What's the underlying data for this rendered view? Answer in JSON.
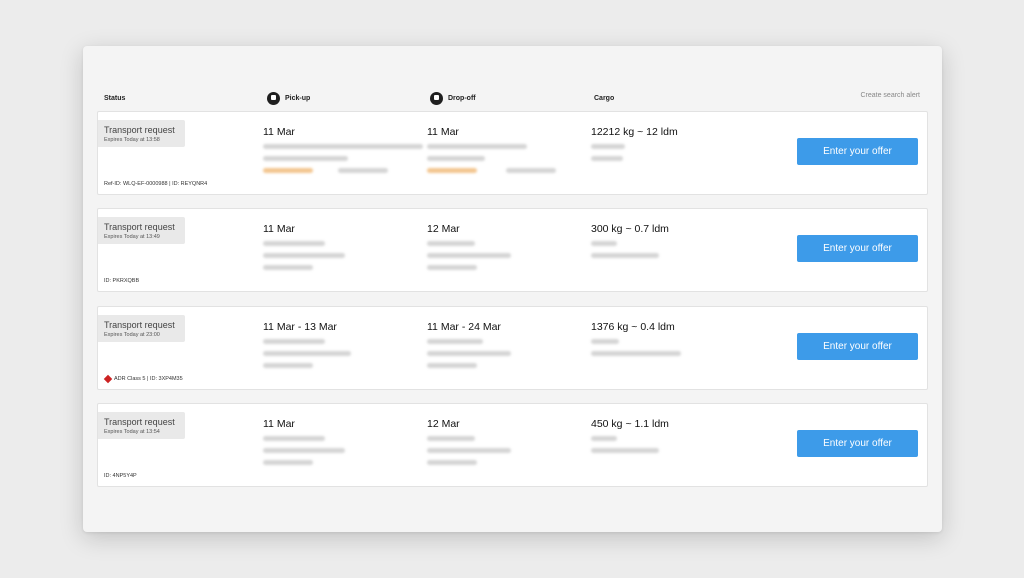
{
  "header": {
    "columns": {
      "status": "Status",
      "pickup": "Pick-up",
      "dropoff": "Drop-off",
      "cargo": "Cargo"
    },
    "search_alert": "Create search alert"
  },
  "requests": [
    {
      "status": "Transport request",
      "expiry": "Expires Today at 13:58",
      "ref": "Ref-ID: WLQ-EF-0000988 | ID: REYQNR4",
      "pickup_date": "11 Mar",
      "dropoff_date": "11 Mar",
      "cargo": "12212 kg ~ 12 ldm",
      "offer_label": "Enter your offer"
    },
    {
      "status": "Transport request",
      "expiry": "Expires Today at 13:49",
      "ref": "ID: PKRXQBB",
      "pickup_date": "11 Mar",
      "dropoff_date": "12 Mar",
      "cargo": "300 kg ~ 0.7 ldm",
      "offer_label": "Enter your offer"
    },
    {
      "status": "Transport request",
      "expiry": "Expires Today at 23:00",
      "ref": "ADR Class 5 | ID: 3XP4M35",
      "pickup_date": "11 Mar - 13 Mar",
      "dropoff_date": "11 Mar - 24 Mar",
      "cargo": "1376 kg ~ 0.4 ldm",
      "offer_label": "Enter your offer"
    },
    {
      "status": "Transport request",
      "expiry": "Expires Today at 13:54",
      "ref": "ID: 4NP5Y4P",
      "pickup_date": "11 Mar",
      "dropoff_date": "12 Mar",
      "cargo": "450 kg ~ 1.1 ldm",
      "offer_label": "Enter your offer"
    }
  ],
  "colors": {
    "accent": "#3d9be9",
    "window_bg": "#f4f4f4",
    "status_bg": "#e9e9e9",
    "adr_red": "#cc2222",
    "time_window_orange": "#f3c690"
  },
  "icons": {
    "pickup": "pickup-pin-icon",
    "dropoff": "dropoff-pin-icon",
    "adr": "adr-hazard-icon"
  }
}
